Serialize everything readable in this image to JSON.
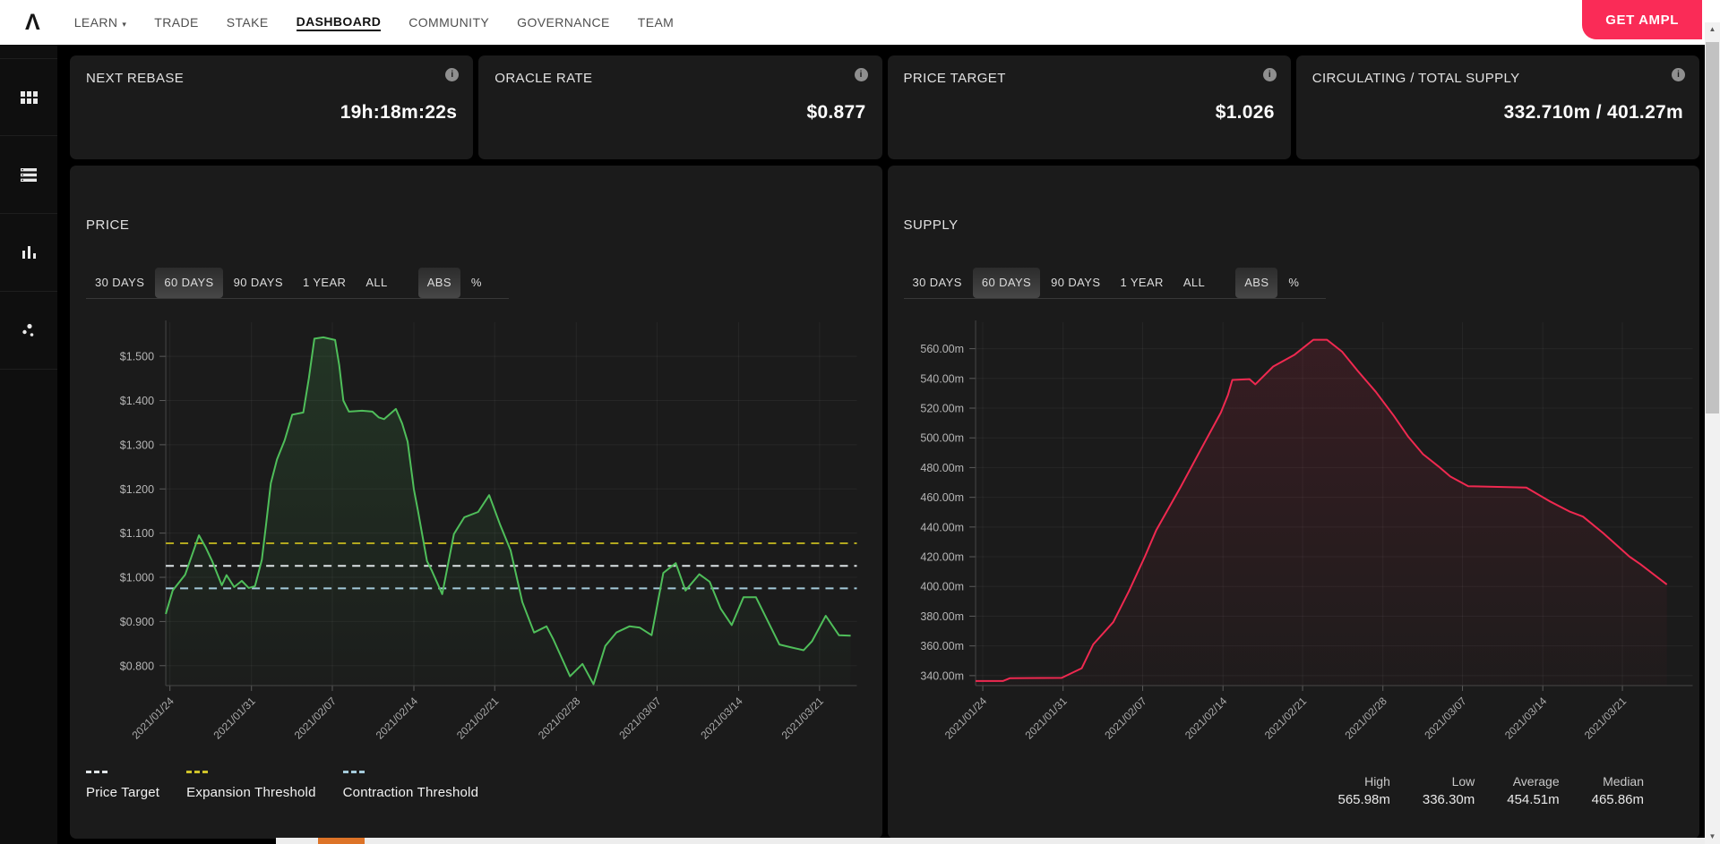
{
  "nav": {
    "logo": "Λ",
    "items": [
      {
        "label": "LEARN",
        "has_dropdown": true,
        "active": false
      },
      {
        "label": "TRADE",
        "has_dropdown": false,
        "active": false
      },
      {
        "label": "STAKE",
        "has_dropdown": false,
        "active": false
      },
      {
        "label": "DASHBOARD",
        "has_dropdown": false,
        "active": true
      },
      {
        "label": "COMMUNITY",
        "has_dropdown": false,
        "active": false
      },
      {
        "label": "GOVERNANCE",
        "has_dropdown": false,
        "active": false
      },
      {
        "label": "TEAM",
        "has_dropdown": false,
        "active": false
      }
    ],
    "cta": "GET AMPL",
    "cta_color": "#fa2b57"
  },
  "glyphs": {
    "dropdown": "▾",
    "info": "i",
    "scroll_up": "▲",
    "scroll_down": "▼"
  },
  "sidebar": {
    "items": [
      "grid-icon",
      "list-icon",
      "bar-chart-icon",
      "scatter-icon"
    ]
  },
  "cards": [
    {
      "title": "NEXT REBASE",
      "value": "19h:18m:22s"
    },
    {
      "title": "ORACLE RATE",
      "value": "$0.877"
    },
    {
      "title": "PRICE TARGET",
      "value": "$1.026"
    },
    {
      "title": "CIRCULATING / TOTAL SUPPLY",
      "value": "332.710m / 401.27m"
    }
  ],
  "range_tabs": [
    "30 DAYS",
    "60 DAYS",
    "90 DAYS",
    "1 YEAR",
    "ALL"
  ],
  "mode_tabs": [
    "ABS",
    "%"
  ],
  "selected_range": "60 DAYS",
  "selected_mode": "ABS",
  "price_panel": {
    "title": "PRICE",
    "legend": [
      {
        "label": "Price Target",
        "color": "#e0e5e8"
      },
      {
        "label": "Expansion Threshold",
        "color": "#cfc32a"
      },
      {
        "label": "Contraction Threshold",
        "color": "#a5cbdb"
      }
    ]
  },
  "supply_panel": {
    "title": "SUPPLY",
    "stats": [
      {
        "label": "High",
        "value": "565.98m"
      },
      {
        "label": "Low",
        "value": "336.30m"
      },
      {
        "label": "Average",
        "value": "454.51m"
      },
      {
        "label": "Median",
        "value": "465.86m"
      }
    ]
  },
  "chart_data": [
    {
      "type": "line",
      "name": "price",
      "title": "PRICE",
      "unit": "USD",
      "color": "#4fbe5a",
      "fill_from": "rgba(77,190,90,0.16)",
      "fill_to": "rgba(77,190,90,0.01)",
      "ylim": [
        0.755,
        1.557
      ],
      "grid": true,
      "yticks": [
        {
          "value": 1.5,
          "label": "$1.500"
        },
        {
          "value": 1.4,
          "label": "$1.400"
        },
        {
          "value": 1.3,
          "label": "$1.300"
        },
        {
          "value": 1.2,
          "label": "$1.200"
        },
        {
          "value": 1.1,
          "label": "$1.100"
        },
        {
          "value": 1.0,
          "label": "$1.000"
        },
        {
          "value": 0.9,
          "label": "$0.900"
        },
        {
          "value": 0.8,
          "label": "$0.800"
        }
      ],
      "x_labels": [
        "2021/01/24",
        "2021/01/31",
        "2021/02/07",
        "2021/02/14",
        "2021/02/21",
        "2021/02/28",
        "2021/03/07",
        "2021/03/14",
        "2021/03/21"
      ],
      "x_positions": [
        0.006,
        0.124,
        0.241,
        0.359,
        0.476,
        0.594,
        0.711,
        0.829,
        0.946
      ],
      "thresholds": [
        {
          "name": "Expansion Threshold",
          "value": 1.077,
          "color": "#b3a81f"
        },
        {
          "name": "Price Target",
          "value": 1.026,
          "color": "#dde3e6"
        },
        {
          "name": "Contraction Threshold",
          "value": 0.975,
          "color": "#a5cbdb"
        }
      ],
      "points": [
        [
          0.0,
          0.917
        ],
        [
          0.01,
          0.97
        ],
        [
          0.028,
          1.006
        ],
        [
          0.048,
          1.095
        ],
        [
          0.058,
          1.067
        ],
        [
          0.067,
          1.037
        ],
        [
          0.081,
          0.982
        ],
        [
          0.088,
          1.005
        ],
        [
          0.099,
          0.978
        ],
        [
          0.11,
          0.992
        ],
        [
          0.12,
          0.976
        ],
        [
          0.129,
          0.98
        ],
        [
          0.139,
          1.04
        ],
        [
          0.145,
          1.118
        ],
        [
          0.152,
          1.213
        ],
        [
          0.161,
          1.267
        ],
        [
          0.172,
          1.31
        ],
        [
          0.183,
          1.368
        ],
        [
          0.199,
          1.373
        ],
        [
          0.207,
          1.45
        ],
        [
          0.215,
          1.54
        ],
        [
          0.228,
          1.543
        ],
        [
          0.245,
          1.537
        ],
        [
          0.251,
          1.48
        ],
        [
          0.257,
          1.4
        ],
        [
          0.265,
          1.375
        ],
        [
          0.284,
          1.377
        ],
        [
          0.299,
          1.375
        ],
        [
          0.308,
          1.362
        ],
        [
          0.316,
          1.358
        ],
        [
          0.333,
          1.381
        ],
        [
          0.342,
          1.348
        ],
        [
          0.35,
          1.307
        ],
        [
          0.359,
          1.199
        ],
        [
          0.365,
          1.15
        ],
        [
          0.378,
          1.037
        ],
        [
          0.385,
          1.015
        ],
        [
          0.4,
          0.962
        ],
        [
          0.417,
          1.098
        ],
        [
          0.432,
          1.136
        ],
        [
          0.452,
          1.148
        ],
        [
          0.468,
          1.186
        ],
        [
          0.484,
          1.118
        ],
        [
          0.499,
          1.061
        ],
        [
          0.516,
          0.944
        ],
        [
          0.533,
          0.875
        ],
        [
          0.551,
          0.889
        ],
        [
          0.561,
          0.859
        ],
        [
          0.585,
          0.776
        ],
        [
          0.603,
          0.804
        ],
        [
          0.619,
          0.758
        ],
        [
          0.636,
          0.845
        ],
        [
          0.652,
          0.875
        ],
        [
          0.671,
          0.889
        ],
        [
          0.686,
          0.886
        ],
        [
          0.703,
          0.869
        ],
        [
          0.72,
          1.01
        ],
        [
          0.738,
          1.032
        ],
        [
          0.752,
          0.97
        ],
        [
          0.772,
          1.007
        ],
        [
          0.787,
          0.99
        ],
        [
          0.803,
          0.929
        ],
        [
          0.819,
          0.892
        ],
        [
          0.836,
          0.955
        ],
        [
          0.854,
          0.955
        ],
        [
          0.888,
          0.848
        ],
        [
          0.906,
          0.841
        ],
        [
          0.923,
          0.835
        ],
        [
          0.935,
          0.855
        ],
        [
          0.955,
          0.913
        ],
        [
          0.974,
          0.869
        ],
        [
          0.991,
          0.868
        ]
      ]
    },
    {
      "type": "line",
      "name": "supply",
      "title": "SUPPLY",
      "unit": "AMPL (millions)",
      "color": "#ef2950",
      "fill_from": "rgba(239,41,80,0.13)",
      "fill_to": "rgba(239,41,80,0.02)",
      "ylim": [
        333.3,
        571.8
      ],
      "grid": true,
      "yticks": [
        {
          "value": 560,
          "label": "560.00m"
        },
        {
          "value": 540,
          "label": "540.00m"
        },
        {
          "value": 520,
          "label": "520.00m"
        },
        {
          "value": 500,
          "label": "500.00m"
        },
        {
          "value": 480,
          "label": "480.00m"
        },
        {
          "value": 460,
          "label": "460.00m"
        },
        {
          "value": 440,
          "label": "440.00m"
        },
        {
          "value": 420,
          "label": "420.00m"
        },
        {
          "value": 400,
          "label": "400.00m"
        },
        {
          "value": 380,
          "label": "380.00m"
        },
        {
          "value": 360,
          "label": "360.00m"
        },
        {
          "value": 340,
          "label": "340.00m"
        }
      ],
      "x_labels": [
        "2021/01/24",
        "2021/01/31",
        "2021/02/07",
        "2021/02/14",
        "2021/02/21",
        "2021/02/28",
        "2021/03/07",
        "2021/03/14",
        "2021/03/21"
      ],
      "x_positions": [
        0.01,
        0.122,
        0.233,
        0.345,
        0.456,
        0.568,
        0.679,
        0.791,
        0.902
      ],
      "thresholds": [],
      "points": [
        [
          0.0,
          336.4
        ],
        [
          0.038,
          336.4
        ],
        [
          0.048,
          338.3
        ],
        [
          0.12,
          338.5
        ],
        [
          0.148,
          345
        ],
        [
          0.164,
          361
        ],
        [
          0.192,
          376
        ],
        [
          0.214,
          397
        ],
        [
          0.236,
          420
        ],
        [
          0.252,
          438
        ],
        [
          0.286,
          467
        ],
        [
          0.315,
          493
        ],
        [
          0.342,
          517
        ],
        [
          0.352,
          529
        ],
        [
          0.358,
          539
        ],
        [
          0.382,
          539.5
        ],
        [
          0.39,
          536
        ],
        [
          0.415,
          548
        ],
        [
          0.445,
          556
        ],
        [
          0.471,
          566
        ],
        [
          0.49,
          566
        ],
        [
          0.511,
          558
        ],
        [
          0.533,
          545
        ],
        [
          0.558,
          531
        ],
        [
          0.583,
          515
        ],
        [
          0.603,
          501
        ],
        [
          0.624,
          489
        ],
        [
          0.645,
          481
        ],
        [
          0.662,
          474
        ],
        [
          0.687,
          467.5
        ],
        [
          0.768,
          466.5
        ],
        [
          0.8,
          457.5
        ],
        [
          0.828,
          450.5
        ],
        [
          0.847,
          447
        ],
        [
          0.875,
          436
        ],
        [
          0.912,
          420
        ],
        [
          0.927,
          415
        ],
        [
          0.964,
          401.3
        ]
      ],
      "summary": {
        "high": "565.98m",
        "low": "336.30m",
        "average": "454.51m",
        "median": "465.86m"
      }
    }
  ]
}
